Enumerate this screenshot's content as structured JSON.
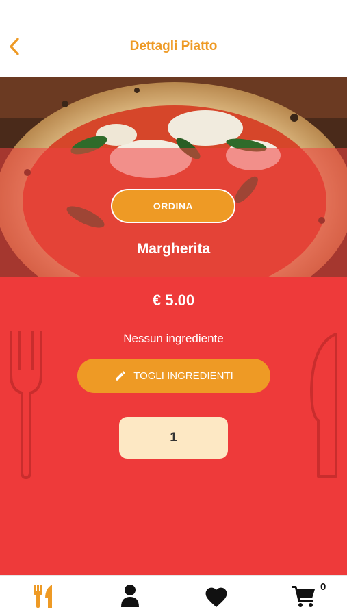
{
  "header": {
    "title": "Dettagli Piatto",
    "back_icon": "chevron-left-icon"
  },
  "dish": {
    "name": "Margherita",
    "order_label": "ORDINA",
    "price": "€ 5.00",
    "ingredients_text": "Nessun ingrediente",
    "remove_ingredients_label": "TOGLI INGREDIENTI",
    "quantity": "1"
  },
  "tabbar": {
    "items": [
      {
        "name": "menu",
        "icon": "fork-knife-icon",
        "active": true
      },
      {
        "name": "profile",
        "icon": "user-icon",
        "active": false
      },
      {
        "name": "favorites",
        "icon": "heart-icon",
        "active": false
      },
      {
        "name": "cart",
        "icon": "cart-icon",
        "active": false
      }
    ],
    "cart_count": "0"
  },
  "colors": {
    "accent": "#ee9a25",
    "primary_red": "#ee3a3a",
    "quantity_bg": "#fde8c4",
    "tab_inactive": "#111111"
  }
}
